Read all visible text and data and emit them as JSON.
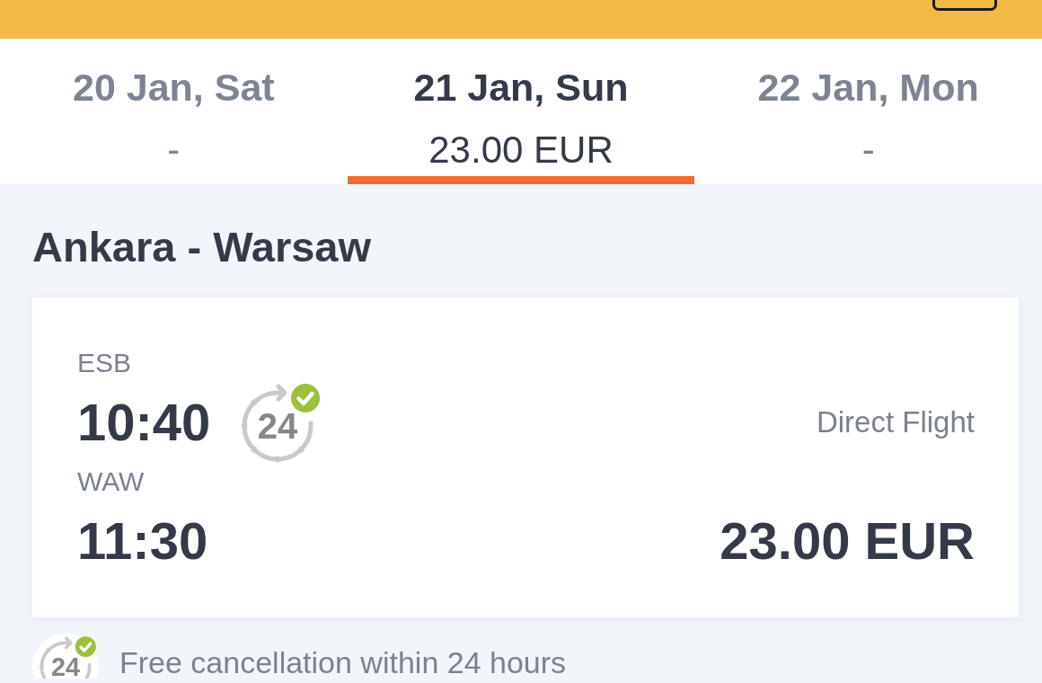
{
  "date_tabs": [
    {
      "date": "20 Jan, Sat",
      "price": "-",
      "selected": false
    },
    {
      "date": "21 Jan, Sun",
      "price": "23.00 EUR",
      "selected": true
    },
    {
      "date": "22 Jan, Mon",
      "price": "-",
      "selected": false
    }
  ],
  "route": {
    "title": "Ankara - Warsaw"
  },
  "flight": {
    "departure_airport": "ESB",
    "departure_time": "10:40",
    "cancellation_icon_text": "24",
    "flight_type": "Direct Flight",
    "arrival_airport": "WAW",
    "arrival_time": "11:30",
    "price": "23.00 EUR"
  },
  "cancellation_note": {
    "icon_text": "24",
    "text": "Free cancellation within 24 hours"
  }
}
